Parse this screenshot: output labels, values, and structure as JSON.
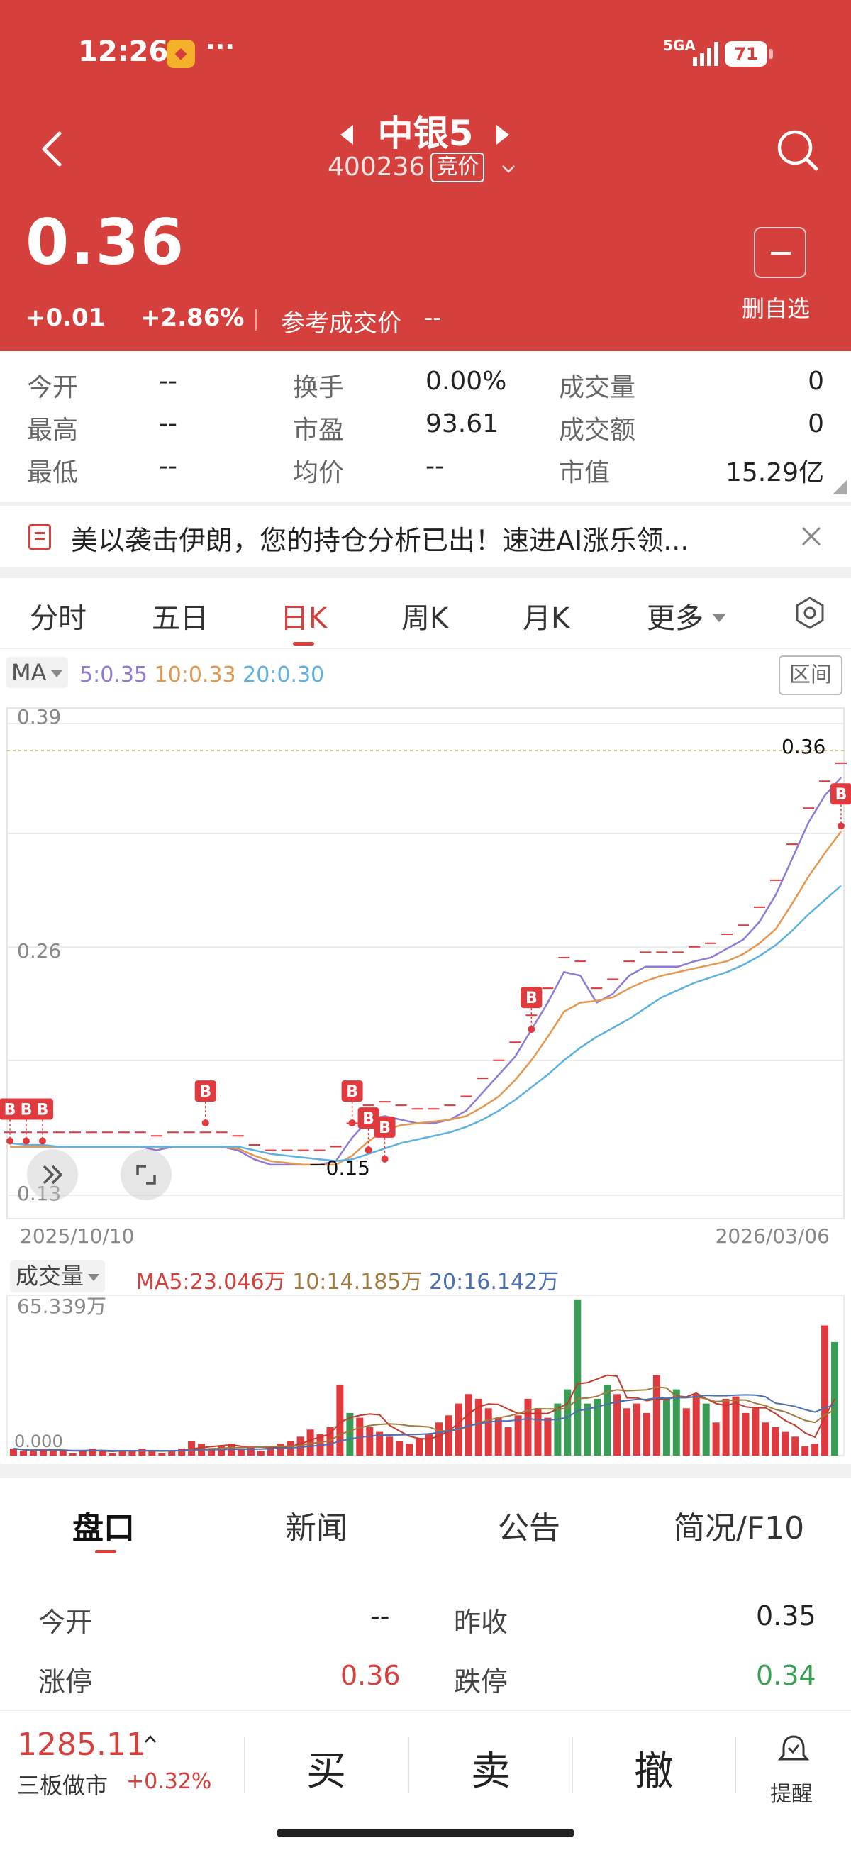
{
  "status_bar": {
    "time": "12:26",
    "dots": "···",
    "network": "5GA",
    "battery": "71"
  },
  "header": {
    "title": "中银5",
    "code": "400236",
    "bid_tag": "竞价",
    "price": "0.36",
    "change": "+0.01",
    "change_pct": "+2.86%",
    "ref_price_label": "参考成交价",
    "ref_price_value": "--",
    "watchlist_label": "删自选"
  },
  "quote": {
    "open_label": "今开",
    "open": "--",
    "high_label": "最高",
    "high": "--",
    "low_label": "最低",
    "low": "--",
    "turnover_label": "换手",
    "turnover": "0.00%",
    "pe_label": "市盈",
    "pe": "93.61",
    "avg_label": "均价",
    "avg": "--",
    "volume_label": "成交量",
    "volume": "0",
    "amount_label": "成交额",
    "amount": "0",
    "mktcap_label": "市值",
    "mktcap": "15.29亿"
  },
  "banner": {
    "text": "美以袭击伊朗，您的持仓分析已出！速进AI涨乐领..."
  },
  "period_tabs": [
    "分时",
    "五日",
    "日K",
    "周K",
    "月K",
    "更多"
  ],
  "ma_legend": {
    "selector": "MA",
    "ma5": "5:0.35",
    "ma10": "10:0.33",
    "ma20": "20:0.30",
    "range_button": "区间"
  },
  "colors": {
    "accent": "#d6403c",
    "up": "#e0393e",
    "down": "#3a9d55",
    "ma5": "#8f7ad6",
    "ma10": "#e3984f",
    "ma20": "#5cb1e0"
  },
  "chart_data": [
    {
      "type": "line",
      "yticks": [
        "0.39",
        "0.26",
        "0.13"
      ],
      "ylim": [
        0.13,
        0.39
      ],
      "x_start": "2025/10/10",
      "x_end": "2026/03/06",
      "annotations": [
        "0.36",
        "0.15"
      ],
      "marker_label": "B",
      "series": [
        {
          "name": "5",
          "values": [
            0.155,
            0.155,
            0.155,
            0.155,
            0.155,
            0.155,
            0.155,
            0.155,
            0.155,
            0.153,
            0.155,
            0.155,
            0.155,
            0.155,
            0.153,
            0.148,
            0.145,
            0.145,
            0.145,
            0.145,
            0.147,
            0.16,
            0.17,
            0.172,
            0.17,
            0.168,
            0.168,
            0.17,
            0.175,
            0.185,
            0.195,
            0.205,
            0.22,
            0.235,
            0.252,
            0.25,
            0.235,
            0.24,
            0.25,
            0.255,
            0.255,
            0.255,
            0.258,
            0.26,
            0.265,
            0.27,
            0.28,
            0.295,
            0.315,
            0.335,
            0.35,
            0.36
          ]
        },
        {
          "name": "10",
          "values": [
            0.155,
            0.155,
            0.155,
            0.155,
            0.155,
            0.155,
            0.155,
            0.155,
            0.155,
            0.155,
            0.155,
            0.155,
            0.155,
            0.155,
            0.154,
            0.15,
            0.147,
            0.146,
            0.145,
            0.145,
            0.145,
            0.15,
            0.158,
            0.164,
            0.167,
            0.168,
            0.169,
            0.17,
            0.172,
            0.177,
            0.183,
            0.192,
            0.203,
            0.216,
            0.23,
            0.235,
            0.236,
            0.238,
            0.243,
            0.247,
            0.25,
            0.252,
            0.254,
            0.256,
            0.258,
            0.262,
            0.268,
            0.276,
            0.29,
            0.305,
            0.318,
            0.33
          ]
        },
        {
          "name": "20",
          "values": [
            0.157,
            0.156,
            0.156,
            0.155,
            0.155,
            0.155,
            0.155,
            0.155,
            0.155,
            0.155,
            0.155,
            0.155,
            0.155,
            0.155,
            0.155,
            0.153,
            0.151,
            0.15,
            0.149,
            0.148,
            0.147,
            0.148,
            0.151,
            0.154,
            0.157,
            0.159,
            0.161,
            0.163,
            0.166,
            0.17,
            0.175,
            0.181,
            0.188,
            0.195,
            0.203,
            0.21,
            0.216,
            0.221,
            0.226,
            0.232,
            0.238,
            0.242,
            0.246,
            0.249,
            0.252,
            0.256,
            0.261,
            0.267,
            0.275,
            0.284,
            0.292,
            0.3
          ]
        }
      ]
    },
    {
      "type": "bar",
      "title": "成交量",
      "ylim": [
        0,
        65.339
      ],
      "max_label": "65.339万",
      "base_label": "0.000",
      "ma_legend": {
        "ma5": "MA5:23.046万",
        "ma10": "10:14.185万",
        "ma20": "20:16.142万"
      },
      "values": [
        3,
        2,
        2,
        3,
        2,
        2,
        1,
        2,
        3,
        2,
        1,
        2,
        2,
        3,
        2,
        1,
        2,
        3,
        6,
        5,
        3,
        4,
        5,
        3,
        4,
        2,
        3,
        5,
        6,
        8,
        11,
        9,
        12,
        30,
        18,
        16,
        12,
        10,
        8,
        6,
        5,
        7,
        9,
        14,
        17,
        22,
        26,
        24,
        20,
        16,
        12,
        17,
        24,
        20,
        16,
        22,
        28,
        66,
        22,
        24,
        30,
        26,
        20,
        22,
        18,
        34,
        24,
        28,
        20,
        26,
        22,
        14,
        24,
        25,
        18,
        20,
        14,
        12,
        10,
        8,
        4,
        5,
        55,
        48
      ],
      "directions": [
        "u",
        "u",
        "u",
        "u",
        "u",
        "u",
        "u",
        "u",
        "u",
        "u",
        "u",
        "u",
        "u",
        "u",
        "u",
        "u",
        "u",
        "u",
        "u",
        "u",
        "u",
        "u",
        "u",
        "u",
        "u",
        "u",
        "u",
        "u",
        "u",
        "u",
        "u",
        "u",
        "u",
        "u",
        "d",
        "u",
        "u",
        "u",
        "u",
        "u",
        "u",
        "u",
        "u",
        "u",
        "u",
        "u",
        "u",
        "u",
        "u",
        "u",
        "u",
        "u",
        "u",
        "u",
        "u",
        "d",
        "d",
        "d",
        "d",
        "d",
        "d",
        "u",
        "u",
        "u",
        "u",
        "u",
        "d",
        "d",
        "u",
        "u",
        "d",
        "u",
        "u",
        "u",
        "u",
        "u",
        "u",
        "u",
        "u",
        "u",
        "u",
        "u",
        "u",
        "d"
      ]
    }
  ],
  "bottom_tabs": [
    "盘口",
    "新闻",
    "公告",
    "简况/F10"
  ],
  "info": {
    "open_label": "今开",
    "open": "--",
    "prev_close_label": "昨收",
    "prev_close": "0.35",
    "limit_up_label": "涨停",
    "limit_up": "0.36",
    "limit_down_label": "跌停",
    "limit_down": "0.34"
  },
  "trade_bar": {
    "index_value": "1285.11",
    "index_name": "三板做市",
    "index_change": "+0.32%",
    "buy": "买",
    "sell": "卖",
    "cancel": "撤",
    "alert_label": "提醒"
  }
}
